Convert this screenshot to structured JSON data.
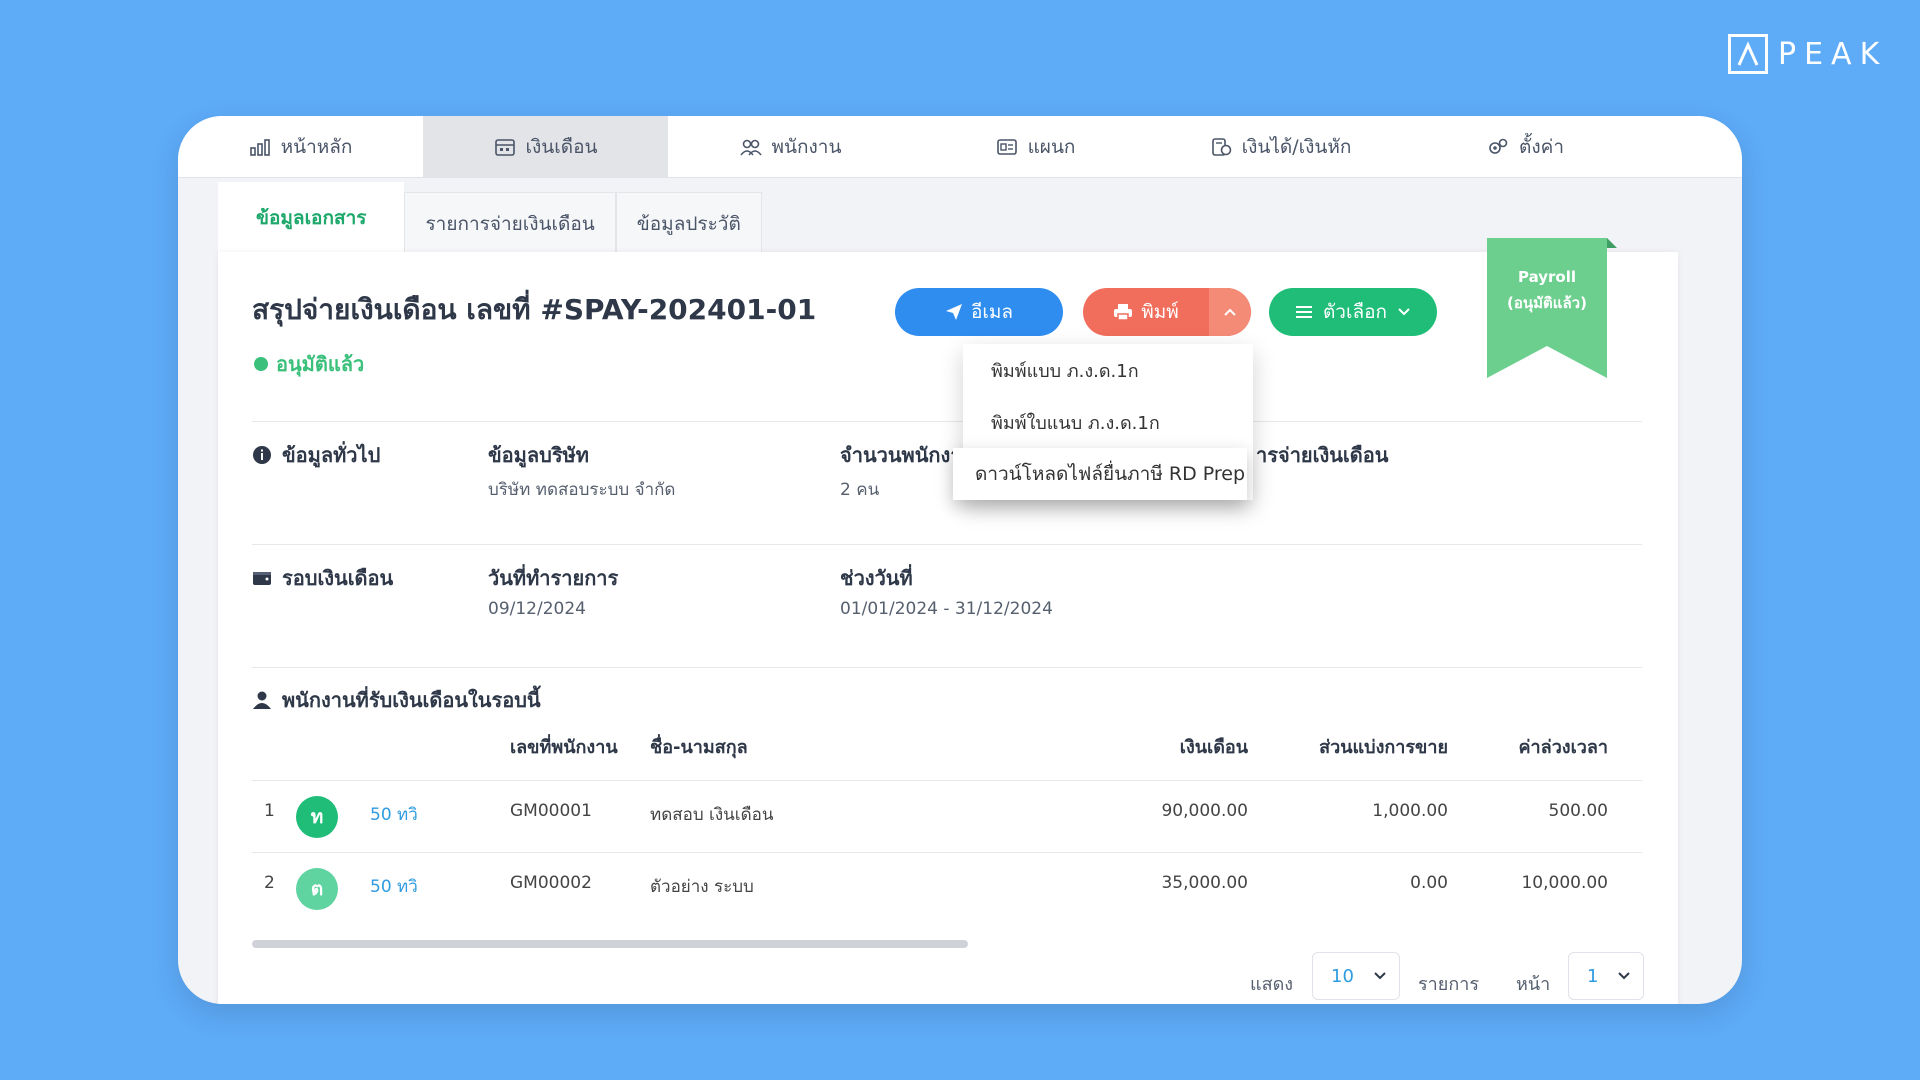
{
  "brand": {
    "logo_text": "PEAK"
  },
  "topnav": [
    {
      "label": "หน้าหลัก",
      "icon": "chart-icon"
    },
    {
      "label": "เงินเดือน",
      "icon": "calendar-icon",
      "active": true
    },
    {
      "label": "พนักงาน",
      "icon": "people-icon"
    },
    {
      "label": "แผนก",
      "icon": "id-card-icon"
    },
    {
      "label": "เงินได้/เงินหัก",
      "icon": "money-icon"
    },
    {
      "label": "ตั้งค่า",
      "icon": "gear-icon"
    }
  ],
  "subtabs": [
    {
      "label": "ข้อมูลเอกสาร",
      "active": true
    },
    {
      "label": "รายการจ่ายเงินเดือน"
    },
    {
      "label": "ข้อมูลประวัติ"
    }
  ],
  "document": {
    "title": "สรุปจ่ายเงินเดือน เลขที่ #SPAY-202401-01",
    "status": "อนุมัติแล้ว"
  },
  "actions": {
    "email_label": "อีเมล",
    "print_label": "พิมพ์",
    "options_label": "ตัวเลือก"
  },
  "ribbon": {
    "line1": "Payroll",
    "line2": "(อนุมัติแล้ว)"
  },
  "print_menu": [
    "พิมพ์แบบ ภ.ง.ด.1ก",
    "พิมพ์ใบแนบ ภ.ง.ด.1ก",
    "ดาวน์โหลดไฟล์ยื่นภาษี RD Prep"
  ],
  "general": {
    "title": "ข้อมูลทั่วไป",
    "company_label": "ข้อมูลบริษัท",
    "company_value": "บริษัท ทดสอบระบบ จำกัด",
    "employees_label": "จำนวนพนักงา",
    "employees_value": "2 คน",
    "payment_label": "ารจ่ายเงินเดือน"
  },
  "cycle": {
    "title": "รอบเงินเดือน",
    "date_label": "วันที่ทำรายการ",
    "date_value": "09/12/2024",
    "range_label": "ช่วงวันที่",
    "range_value": "01/01/2024 - 31/12/2024"
  },
  "employees_section": {
    "title": "พนักงานที่รับเงินเดือนในรอบนี้",
    "columns": {
      "emp_id": "เลขที่พนักงาน",
      "name": "ชื่อ-นามสกุล",
      "salary": "เงินเดือน",
      "commission": "ส่วนแบ่งการขาย",
      "overtime": "ค่าล่วงเวลา"
    },
    "rows": [
      {
        "no": "1",
        "avatar": "ท",
        "avatar_color": "#1fbd77",
        "tag": "50 ทวิ",
        "emp_id": "GM00001",
        "name": "ทดสอบ เงินเดือน",
        "salary": "90,000.00",
        "commission": "1,000.00",
        "overtime": "500.00"
      },
      {
        "no": "2",
        "avatar": "ต",
        "avatar_color": "#5fd3a0",
        "tag": "50 ทวิ",
        "emp_id": "GM00002",
        "name": "ตัวอย่าง ระบบ",
        "salary": "35,000.00",
        "commission": "0.00",
        "overtime": "10,000.00"
      }
    ]
  },
  "pagination": {
    "show_label": "แสดง",
    "page_size": "10",
    "items_label": "รายการ",
    "page_label": "หน้า",
    "page": "1"
  },
  "colors": {
    "background": "#5eabf8",
    "email": "#2f8def",
    "print": "#f06e5b",
    "options": "#1fbd77",
    "approved": "#3ac07a",
    "ribbon": "#6ccf8e"
  }
}
